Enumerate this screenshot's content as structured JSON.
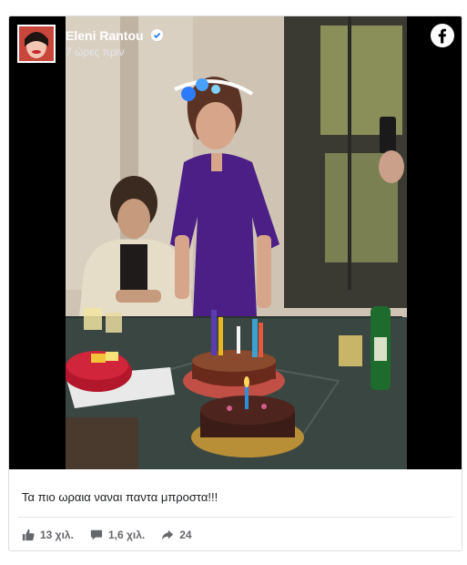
{
  "post": {
    "author_name": "Eleni Rantou",
    "timestamp": "7 ώρες πριν",
    "caption": "Τα πιο ωραια ναναι παντα μπροστα!!!"
  },
  "reactions": {
    "likes": "13 χιλ.",
    "comments": "1,6 χιλ.",
    "shares": "24"
  },
  "icons": {
    "verified": "verified-badge-icon",
    "brand": "facebook-logo-icon",
    "like": "thumbs-up-icon",
    "comment": "comment-bubble-icon",
    "share": "share-arrow-icon"
  },
  "colors": {
    "text_primary": "#1c1e21",
    "text_secondary": "#65676b",
    "border": "#dadde1"
  }
}
